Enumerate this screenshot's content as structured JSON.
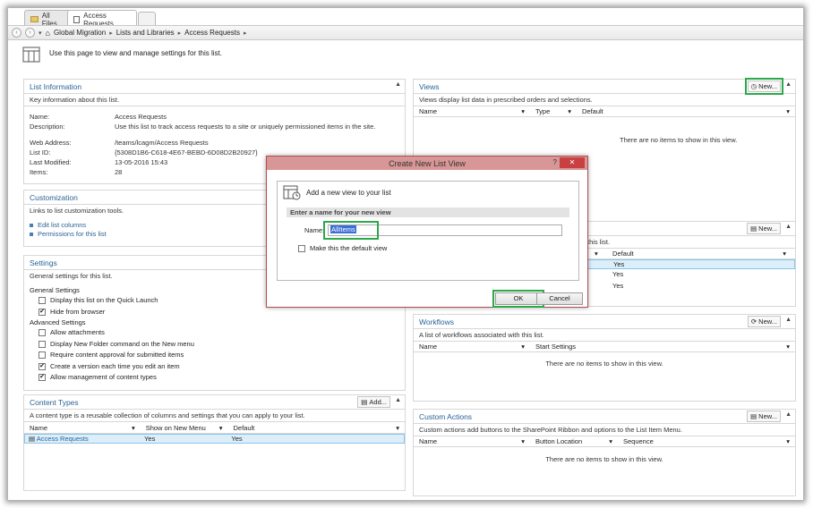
{
  "tabs": [
    {
      "label": "All Files"
    },
    {
      "label": "Access Requests"
    }
  ],
  "breadcrumb": [
    "Global Migration",
    "Lists and Libraries",
    "Access Requests"
  ],
  "intro": "Use this page to view and manage settings for this list.",
  "list_info": {
    "title": "List Information",
    "desc": "Key information about this list.",
    "name_label": "Name:",
    "name_value": "Access Requests",
    "description_label": "Description:",
    "description_value": "Use this list to track access requests to a site or uniquely permissioned items in the site.",
    "web_label": "Web Address:",
    "web_value": "/teams/lcagm/Access Requests",
    "listid_label": "List ID:",
    "listid_value": "{5308D1B6-C618-4E67-BEBD-6D08D2B20927}",
    "modified_label": "Last Modified:",
    "modified_value": "13-05-2016 15:43",
    "items_label": "Items:",
    "items_value": "28"
  },
  "customization": {
    "title": "Customization",
    "desc": "Links to list customization tools.",
    "links": [
      "Edit list columns",
      "Permissions for this list"
    ]
  },
  "settings": {
    "title": "Settings",
    "desc": "General settings for this list.",
    "general_heading": "General Settings",
    "general": [
      {
        "label": "Display this list on the Quick Launch",
        "checked": false
      },
      {
        "label": "Hide from browser",
        "checked": true
      }
    ],
    "advanced_heading": "Advanced Settings",
    "advanced": [
      {
        "label": "Allow attachments",
        "checked": false
      },
      {
        "label": "Display New Folder command on the New menu",
        "checked": false
      },
      {
        "label": "Require content approval for submitted items",
        "checked": false
      },
      {
        "label": "Create a version each time you edit an item",
        "checked": true
      },
      {
        "label": "Allow management of content types",
        "checked": true
      }
    ]
  },
  "content_types": {
    "title": "Content Types",
    "add_label": "Add...",
    "desc": "A content type is a reusable collection of columns and settings that you can apply to your list.",
    "col_name": "Name",
    "col_show": "Show on New Menu",
    "col_default": "Default",
    "row": {
      "name": "Access Requests",
      "show": "Yes",
      "default": "Yes"
    }
  },
  "views": {
    "title": "Views",
    "new_label": "New...",
    "desc": "Views display list data in prescribed orders and selections.",
    "col_name": "Name",
    "col_type": "Type",
    "col_default": "Default",
    "empty": "There are no items to show in this view."
  },
  "partial_panel": {
    "new_label": "New...",
    "desc_tail": "this list.",
    "col_default": "Default",
    "values": [
      "Yes",
      "Yes",
      "Yes"
    ]
  },
  "workflows": {
    "title": "Workflows",
    "new_label": "New...",
    "desc": "A list of workflows associated with this list.",
    "col_name": "Name",
    "col_start": "Start Settings",
    "empty": "There are no items to show in this view."
  },
  "custom_actions": {
    "title": "Custom Actions",
    "new_label": "New...",
    "desc": "Custom actions add buttons to the SharePoint Ribbon and options to the List Item Menu.",
    "col_name": "Name",
    "col_button": "Button Location",
    "col_sequence": "Sequence",
    "empty": "There are no items to show in this view."
  },
  "dialog": {
    "title": "Create New List View",
    "help": "?",
    "close": "✕",
    "heading": "Add a new view to your list",
    "section": "Enter a name for your new view",
    "name_label": "Name:",
    "name_value": "AllItems",
    "default_label": "Make this the default view",
    "ok": "OK",
    "cancel": "Cancel"
  },
  "colors": {
    "accent_link": "#2a6496",
    "highlight": "#2ca84a",
    "dialog_title": "#d99696"
  }
}
